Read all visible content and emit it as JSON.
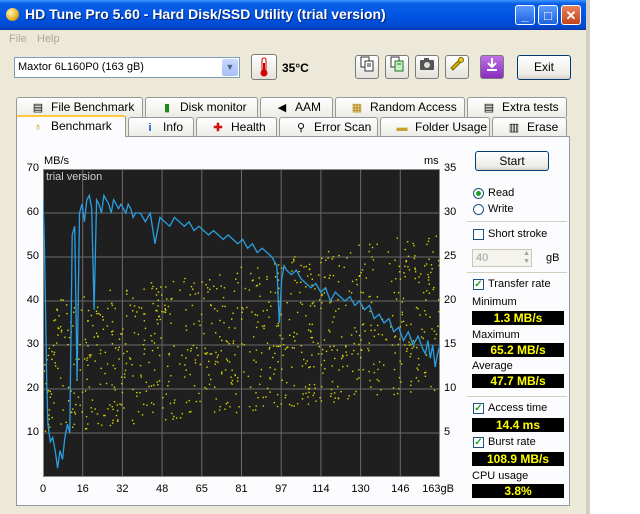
{
  "window": {
    "title": "HD Tune Pro 5.60 - Hard Disk/SSD Utility (trial version)"
  },
  "title_buttons": {
    "minimize": "_",
    "maximize": "□",
    "close": "✕"
  },
  "menu": {
    "items": [
      "File",
      "Help"
    ]
  },
  "toolbar": {
    "drive": "Maxtor 6L160P0 (163 gB)",
    "temperature": "35°C",
    "exit_label": "Exit",
    "icons": [
      "copy-text-icon",
      "copy-info-icon",
      "camera-icon",
      "options-icon",
      "save-icon"
    ]
  },
  "tabs_row1": [
    {
      "label": "File Benchmark",
      "icon": "file-benchmark-icon"
    },
    {
      "label": "Disk monitor",
      "icon": "disk-monitor-icon"
    },
    {
      "label": "AAM",
      "icon": "speaker-icon"
    },
    {
      "label": "Random Access",
      "icon": "random-access-icon"
    },
    {
      "label": "Extra tests",
      "icon": "extra-tests-icon"
    }
  ],
  "tabs_row2": [
    {
      "label": "Benchmark",
      "icon": "benchmark-icon"
    },
    {
      "label": "Info",
      "icon": "info-icon"
    },
    {
      "label": "Health",
      "icon": "health-icon"
    },
    {
      "label": "Error Scan",
      "icon": "magnifier-icon"
    },
    {
      "label": "Folder Usage",
      "icon": "folder-icon"
    },
    {
      "label": "Erase",
      "icon": "trash-icon"
    }
  ],
  "controls": {
    "start_label": "Start",
    "read_label": "Read",
    "write_label": "Write",
    "mode": "Read",
    "short_stroke_label": "Short stroke",
    "short_stroke_checked": false,
    "short_stroke_value": "40",
    "short_stroke_unit": "gB",
    "transfer_rate_label": "Transfer rate",
    "transfer_rate_checked": true,
    "minimum_label": "Minimum",
    "minimum_value": "1.3 MB/s",
    "maximum_label": "Maximum",
    "maximum_value": "65.2 MB/s",
    "average_label": "Average",
    "average_value": "47.7 MB/s",
    "access_time_label": "Access time",
    "access_time_checked": true,
    "access_time_value": "14.4 ms",
    "burst_rate_label": "Burst rate",
    "burst_rate_checked": true,
    "burst_rate_value": "108.9 MB/s",
    "cpu_usage_label": "CPU usage",
    "cpu_usage_value": "3.8%"
  },
  "chart_data": {
    "type": "line",
    "watermark": "trial version",
    "ylabel": "MB/s",
    "y2label": "ms",
    "xlim": [
      0,
      163
    ],
    "ylim": [
      0,
      70
    ],
    "y2lim": [
      0,
      35
    ],
    "x_ticks": [
      "0",
      "16",
      "32",
      "48",
      "65",
      "81",
      "97",
      "114",
      "130",
      "146",
      "163gB"
    ],
    "y_ticks": [
      "70",
      "60",
      "50",
      "40",
      "30",
      "20",
      "10"
    ],
    "y2_ticks": [
      "35",
      "30",
      "25",
      "20",
      "15",
      "10",
      "5"
    ],
    "grid": true,
    "colors": {
      "transfer": "#2a9ee0",
      "access": "#d8d800",
      "background": "#1f1f1f",
      "grid": "#6a6a6a"
    },
    "series": [
      {
        "type": "line",
        "axis": "left",
        "x": [
          0,
          0.5,
          1,
          1.5,
          2,
          3,
          4,
          5,
          6,
          7,
          8,
          9,
          10,
          11,
          12,
          13,
          14,
          15,
          16,
          17,
          18,
          19,
          20,
          21,
          22,
          23,
          24,
          25,
          26,
          27,
          28,
          29,
          30,
          31,
          32,
          33,
          34,
          35,
          36,
          37,
          38,
          40,
          42,
          44,
          46,
          48,
          50,
          52,
          54,
          56,
          58,
          60,
          62,
          64,
          66,
          68,
          70,
          72,
          74,
          76,
          78,
          80,
          82,
          84,
          86,
          88,
          90,
          92,
          94,
          96,
          97,
          98,
          99,
          100,
          102,
          104,
          106,
          108,
          110,
          112,
          114,
          116,
          118,
          120,
          122,
          124,
          126,
          128,
          130,
          132,
          134,
          136,
          138,
          140,
          142,
          144,
          146,
          148,
          150,
          152,
          154,
          156,
          157,
          158,
          159,
          160,
          161,
          162,
          163
        ],
        "y": [
          63,
          55,
          40,
          22,
          12,
          8,
          9,
          6,
          2,
          6,
          4,
          9,
          12,
          10,
          55,
          57,
          22,
          60,
          62,
          58,
          63,
          64,
          61,
          38,
          63,
          62,
          60,
          64,
          63,
          62,
          60,
          63,
          62,
          61,
          62,
          61,
          60,
          62,
          61,
          59,
          60,
          60,
          58,
          60,
          53,
          59,
          58,
          57,
          59,
          58,
          57,
          58,
          56,
          57,
          56,
          55,
          56,
          55,
          54,
          55,
          54,
          53,
          54,
          52,
          53,
          51,
          52,
          51,
          50,
          48,
          35,
          45,
          48,
          47,
          46,
          47,
          45,
          44,
          43,
          44,
          42,
          43,
          40,
          42,
          41,
          40,
          41,
          39,
          40,
          38,
          39,
          36,
          37,
          35,
          36,
          33,
          34,
          31,
          33,
          30,
          32,
          29,
          28,
          31,
          27,
          30,
          25,
          28,
          30
        ]
      },
      {
        "type": "scatter",
        "axis": "right",
        "name": "",
        "spread": [
          5,
          25
        ],
        "mean": 14.4
      }
    ]
  }
}
